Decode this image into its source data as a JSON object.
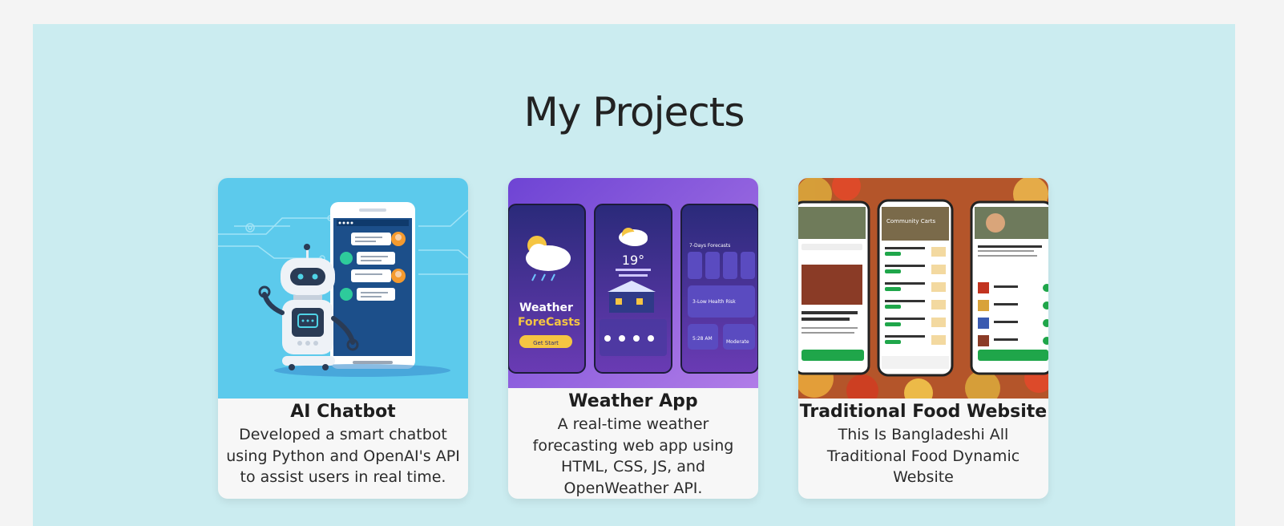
{
  "section": {
    "title": "My Projects"
  },
  "projects": [
    {
      "title": "AI Chatbot",
      "description": "Developed a smart chatbot using Python and OpenAI's API to assist users in real time.",
      "image_subject": "robot-chatbot-illustration"
    },
    {
      "title": "Weather App",
      "description": "A real-time weather forecasting web app using HTML, CSS, JS, and OpenWeather API.",
      "image_subject": "weather-app-phone-mockups",
      "image_text": {
        "brand_line1": "Weather",
        "brand_line2": "ForeCasts",
        "cta": "Get Start",
        "temp": "19°",
        "forecast_heading": "7-Days Forecasts",
        "risk": "3-Low Health Risk",
        "time": "5:28 AM",
        "level": "Moderate"
      }
    },
    {
      "title": "Traditional Food Website",
      "description": "This Is Bangladeshi All Traditional Food Dynamic Website",
      "image_subject": "food-website-phone-mockups",
      "image_text": {
        "heading": "Community Carts"
      }
    }
  ],
  "colors": {
    "section_bg": "#cbecf0",
    "page_bg": "#f4f4f4",
    "card_bg": "#f7f7f7",
    "chatbot_bg": "#5ccaec",
    "weather_bg": "#7a4ad6",
    "food_accent": "#1fa64a"
  }
}
